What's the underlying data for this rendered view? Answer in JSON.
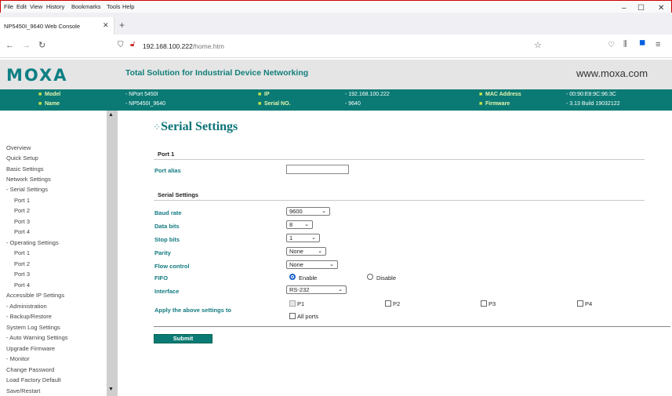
{
  "browser": {
    "menu": [
      "File",
      "Edit",
      "View",
      "History",
      "Bookmarks",
      "Tools",
      "Help"
    ],
    "tab_title": "NP5450I_9640 Web Console",
    "url_host": "192.168.100.222",
    "url_path": "/home.htm"
  },
  "header": {
    "logo": "MOXA",
    "slogan": "Total Solution for Industrial Device Networking",
    "site": "www.moxa.com"
  },
  "info": {
    "model_label": "Model",
    "model_value": "- NPort 5450I",
    "ip_label": "IP",
    "ip_value": "- 192.168.100.222",
    "mac_label": "MAC Address",
    "mac_value": "- 00:90:E8:9C:96:3C",
    "name_label": "Name",
    "name_value": "- NP5450I_9640",
    "serial_label": "Serial NO.",
    "serial_value": "- 9640",
    "firmware_label": "Firmware",
    "firmware_value": "- 3.13 Build 19032122"
  },
  "sidebar": {
    "items": [
      "Overview",
      "Quick Setup",
      "Basic Settings",
      "Network Settings",
      "- Serial Settings",
      "Port 1",
      "Port 2",
      "Port 3",
      "Port 4",
      "- Operating Settings",
      "Port 1",
      "Port 2",
      "Port 3",
      "Port 4",
      "Accessible IP Settings",
      "- Administration",
      "- Backup/Restore",
      "System Log Settings",
      "- Auto Warning Settings",
      "Upgrade Firmware",
      "- Monitor",
      "Change Password",
      "Load Factory Default",
      "Save/Restart"
    ]
  },
  "page": {
    "title": "Serial Settings",
    "section_port": "Port 1",
    "port_alias_label": "Port alias",
    "port_alias_value": "",
    "section_serial": "Serial Settings",
    "baud_label": "Baud rate",
    "baud_value": "9600",
    "data_bits_label": "Data bits",
    "data_bits_value": "8",
    "stop_bits_label": "Stop bits",
    "stop_bits_value": "1",
    "parity_label": "Parity",
    "parity_value": "None",
    "flow_label": "Flow control",
    "flow_value": "None",
    "fifo_label": "FIFO",
    "fifo_enable": "Enable",
    "fifo_disable": "Disable",
    "interface_label": "Interface",
    "interface_value": "RS-232",
    "apply_label": "Apply the above settings to",
    "p1": "P1",
    "p2": "P2",
    "p3": "P3",
    "p4": "P4",
    "all_ports": "All ports",
    "submit": "Submit"
  }
}
